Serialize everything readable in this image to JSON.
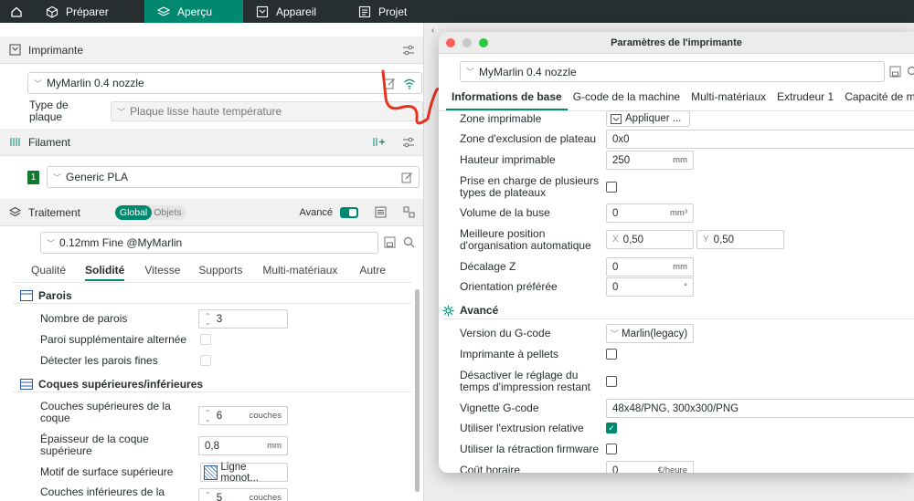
{
  "topbar": {
    "tabs": [
      {
        "label": "Préparer"
      },
      {
        "label": "Aperçu"
      },
      {
        "label": "Appareil"
      },
      {
        "label": "Projet"
      }
    ]
  },
  "left": {
    "printer": {
      "title": "Imprimante",
      "selected": "MyMarlin 0.4 nozzle",
      "plate_label": "Type de plaque",
      "plate_value": "Plaque lisse haute température"
    },
    "filament": {
      "title": "Filament",
      "slot_number": "1",
      "slot_color": "#0e7a2e",
      "selected": "Generic PLA"
    },
    "process": {
      "title": "Traitement",
      "toggle_global": "Global",
      "toggle_objects": "Objets",
      "advanced_label": "Avancé",
      "advanced_on": true,
      "preset": "0.12mm Fine @MyMarlin"
    },
    "subtabs": [
      "Qualité",
      "Solidité",
      "Vitesse",
      "Supports",
      "Multi-matériaux",
      "Autre"
    ],
    "active_subtab": "Solidité",
    "walls": {
      "heading": "Parois",
      "count_label": "Nombre de parois",
      "count_value": "3",
      "alternate_label": "Paroi supplémentaire alternée",
      "thin_label": "Détecter les parois fines"
    },
    "shells": {
      "heading": "Coques supérieures/inférieures",
      "top_layers_label": "Couches supérieures de la coque",
      "top_layers_value": "6",
      "top_layers_unit": "couches",
      "top_thickness_label": "Épaisseur de la coque supérieure",
      "top_thickness_value": "0,8",
      "top_thickness_unit": "mm",
      "top_pattern_label": "Motif de surface supérieure",
      "top_pattern_value": "Ligne monot...",
      "bottom_layers_label": "Couches inférieures de la",
      "bottom_layers_value": "5",
      "bottom_layers_unit": "couches"
    }
  },
  "window": {
    "title": "Paramètres de l'imprimante",
    "preset": "MyMarlin 0.4 nozzle",
    "tabs": [
      "Informations de base",
      "G-code de la machine",
      "Multi-matériaux",
      "Extrudeur 1",
      "Capacité de mouv"
    ],
    "rows": {
      "printable_area_label": "Zone imprimable",
      "printable_area_button": "Appliquer ...",
      "exclusion_label": "Zone d'exclusion de plateau",
      "exclusion_value": "0x0",
      "height_label": "Hauteur imprimable",
      "height_value": "250",
      "height_unit": "mm",
      "multi_plate_label": "Prise en charge de plusieurs types de plateaux",
      "nozzle_volume_label": "Volume de la buse",
      "nozzle_volume_value": "0",
      "nozzle_volume_unit": "mm³",
      "best_pos_label": "Meilleure position d'organisation automatique",
      "best_pos_x_prefix": "X",
      "best_pos_x": "0,50",
      "best_pos_y_prefix": "Y",
      "best_pos_y": "0,50",
      "z_offset_label": "Décalage Z",
      "z_offset_value": "0",
      "z_offset_unit": "mm",
      "orientation_label": "Orientation préférée",
      "orientation_value": "0",
      "orientation_unit": "°"
    },
    "advanced": {
      "heading": "Avancé",
      "gcode_flavor_label": "Version du G-code",
      "gcode_flavor_value": "Marlin(legacy)",
      "pellets_label": "Imprimante à pellets",
      "disable_time_label": "Désactiver le réglage du temps d'impression restant",
      "thumbnail_label": "Vignette G-code",
      "thumbnail_value": "48x48/PNG, 300x300/PNG",
      "relative_extrusion_label": "Utiliser l'extrusion relative",
      "relative_extrusion_on": true,
      "firmware_retraction_label": "Utiliser la rétraction firmware",
      "hourly_cost_label": "Coût horaire",
      "hourly_cost_value": "0",
      "hourly_cost_unit": "€/heure"
    }
  },
  "annotation_color": "#e8331f"
}
